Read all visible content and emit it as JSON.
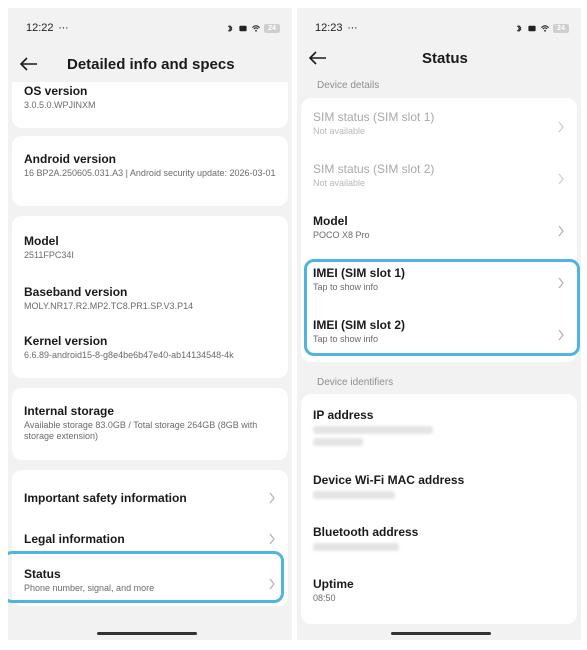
{
  "left": {
    "status_bar": {
      "time": "12:22",
      "extra": "⋯"
    },
    "battery": "24",
    "title": "Detailed info and specs",
    "os": {
      "label": "OS version",
      "value": "3.0.5.0.WPJINXM"
    },
    "android": {
      "label": "Android version",
      "value": "16 BP2A.250605.031.A3 | Android security update: 2026-03-01"
    },
    "model": {
      "label": "Model",
      "value": "2511FPC34I"
    },
    "baseband": {
      "label": "Baseband version",
      "value": "MOLY.NR17.R2.MP2.TC8.PR1.SP.V3.P14"
    },
    "kernel": {
      "label": "Kernel version",
      "value": "6.6.89-android15-8-g8e4be6b47e40-ab14134548-4k"
    },
    "storage": {
      "label": "Internal storage",
      "value": "Available storage  83.0GB / Total storage  264GB (8GB with storage extension)"
    },
    "safety": {
      "label": "Important safety information"
    },
    "legal": {
      "label": "Legal information"
    },
    "status": {
      "label": "Status",
      "value": "Phone number, signal, and more"
    }
  },
  "right": {
    "status_bar": {
      "time": "12:23",
      "extra": "⋯"
    },
    "battery": "24",
    "title": "Status",
    "section_device": "Device details",
    "sim1": {
      "label": "SIM status (SIM slot 1)",
      "value": "Not available"
    },
    "sim2": {
      "label": "SIM status (SIM slot 2)",
      "value": "Not available"
    },
    "model": {
      "label": "Model",
      "value": "POCO X8 Pro"
    },
    "imei1": {
      "label": "IMEI (SIM slot 1)",
      "value": "Tap to show info"
    },
    "imei2": {
      "label": "IMEI (SIM slot 2)",
      "value": "Tap to show info"
    },
    "section_identifiers": "Device identifiers",
    "ip": {
      "label": "IP address"
    },
    "wifi_mac": {
      "label": "Device Wi-Fi MAC address"
    },
    "bt": {
      "label": "Bluetooth address"
    },
    "uptime": {
      "label": "Uptime",
      "value": "08:50"
    }
  },
  "colors": {
    "highlight": "#4fb3e3",
    "background": "#f2f2f2",
    "card": "#ffffff"
  },
  "icons": [
    "back-arrow-icon",
    "chevron-right-icon",
    "bluetooth-icon",
    "wifi-icon",
    "battery-icon",
    "notification-icon"
  ]
}
